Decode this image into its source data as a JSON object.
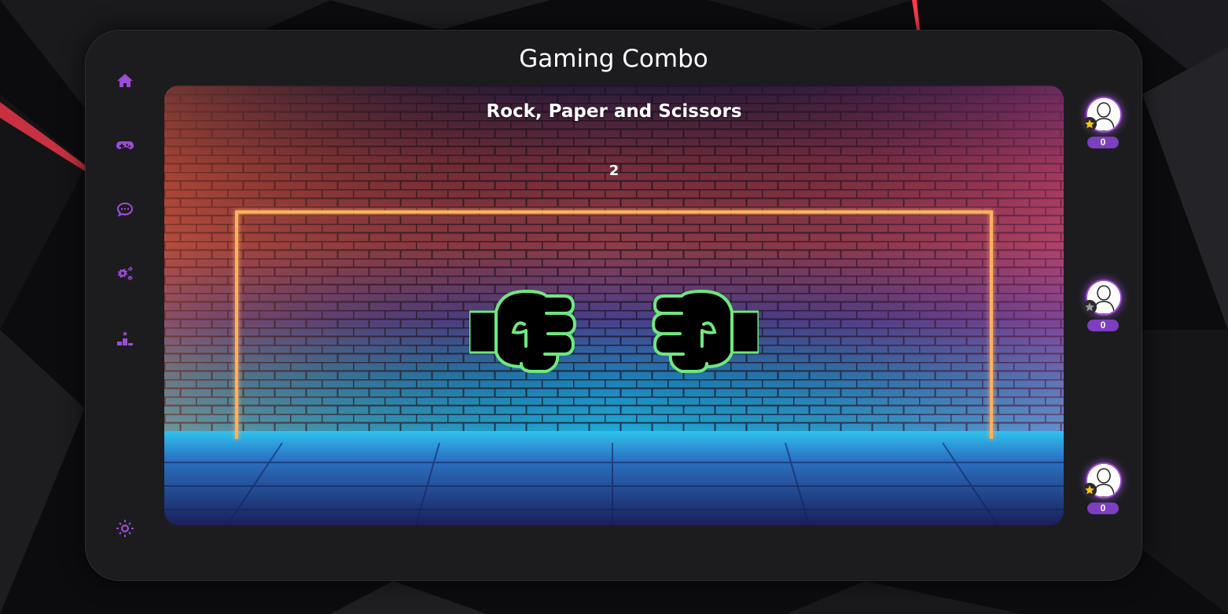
{
  "app": {
    "title": "Gaming Combo"
  },
  "sidebar": {
    "items": [
      {
        "icon": "home-icon"
      },
      {
        "icon": "gamepad-icon"
      },
      {
        "icon": "chat-icon"
      },
      {
        "icon": "settings-gears-icon"
      },
      {
        "icon": "leaderboard-icon"
      }
    ],
    "bottom_icon": "theme-sun-icon"
  },
  "game": {
    "title": "Rock, Paper and Scissors",
    "countdown": "2",
    "left_hand": "rock-fist-icon",
    "right_hand": "rock-fist-icon"
  },
  "players": [
    {
      "score": "0",
      "badge": "gold-star"
    },
    {
      "score": "0",
      "badge": "grey-star"
    },
    {
      "score": "0",
      "badge": "gold-star"
    }
  ],
  "colors": {
    "accent": "#9b4dd6",
    "panel": "#1c1c1e",
    "score_pill": "#7b3fbf",
    "neon_green": "#6ee87e",
    "gold_star": "#f5c518",
    "grey_star": "#9a9a9a"
  }
}
